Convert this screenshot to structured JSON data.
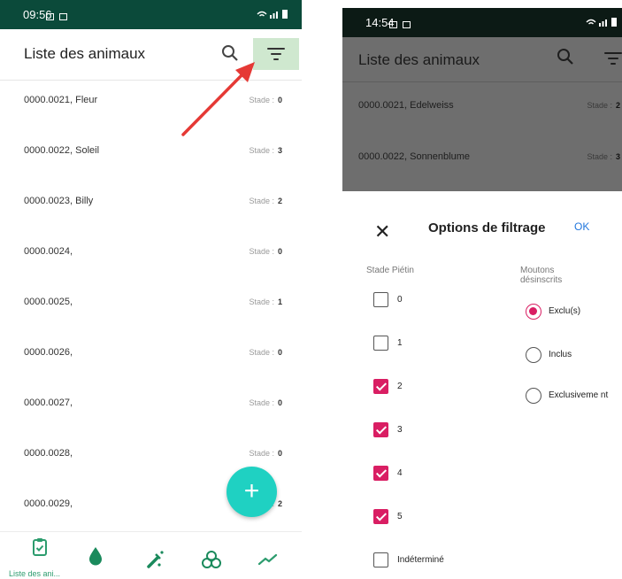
{
  "left": {
    "status_time": "09:56",
    "title": "Liste des animaux",
    "stage_label": "Stade :",
    "rows": [
      {
        "name": "0000.0021, Fleur",
        "stage": "0"
      },
      {
        "name": "0000.0022, Soleil",
        "stage": "3"
      },
      {
        "name": "0000.0023, Billy",
        "stage": "2"
      },
      {
        "name": "0000.0024,",
        "stage": "0"
      },
      {
        "name": "0000.0025,",
        "stage": "1"
      },
      {
        "name": "0000.0026,",
        "stage": "0"
      },
      {
        "name": "0000.0027,",
        "stage": "0"
      },
      {
        "name": "0000.0028,",
        "stage": "0"
      },
      {
        "name": "0000.0029,",
        "stage": "2"
      }
    ],
    "fab_label": "+",
    "nav_label": "Liste des ani...",
    "colors": {
      "status": "#0b4a3a",
      "accent": "#2c9c6e",
      "fab": "#1fd1c2",
      "highlight": "#cfe8cf",
      "arrow": "#e53935"
    }
  },
  "right": {
    "status_time": "14:54",
    "title": "Liste des animaux",
    "stage_label": "Stade :",
    "rows": [
      {
        "name": "0000.0021, Edelweiss",
        "stage": "2"
      },
      {
        "name": "0000.0022, Sonnenblume",
        "stage": "3"
      }
    ],
    "sheet": {
      "close": "✕",
      "title": "Options de filtrage",
      "ok": "OK",
      "stage_header": "Stade Piétin",
      "stage_options": [
        {
          "label": "0",
          "checked": false
        },
        {
          "label": "1",
          "checked": false
        },
        {
          "label": "2",
          "checked": true
        },
        {
          "label": "3",
          "checked": true
        },
        {
          "label": "4",
          "checked": true
        },
        {
          "label": "5",
          "checked": true
        },
        {
          "label": "Indéterminé",
          "checked": false
        }
      ],
      "unsubscribed_header": "Moutons désinscrits",
      "unsubscribed_options": [
        {
          "label": "Exclu(s)",
          "selected": true
        },
        {
          "label": "Inclus",
          "selected": false
        },
        {
          "label": "Exclusiveme nt",
          "selected": false
        }
      ]
    },
    "colors": {
      "check": "#d91e63",
      "ok": "#2277dd",
      "dim": "#6e6e6e"
    }
  }
}
